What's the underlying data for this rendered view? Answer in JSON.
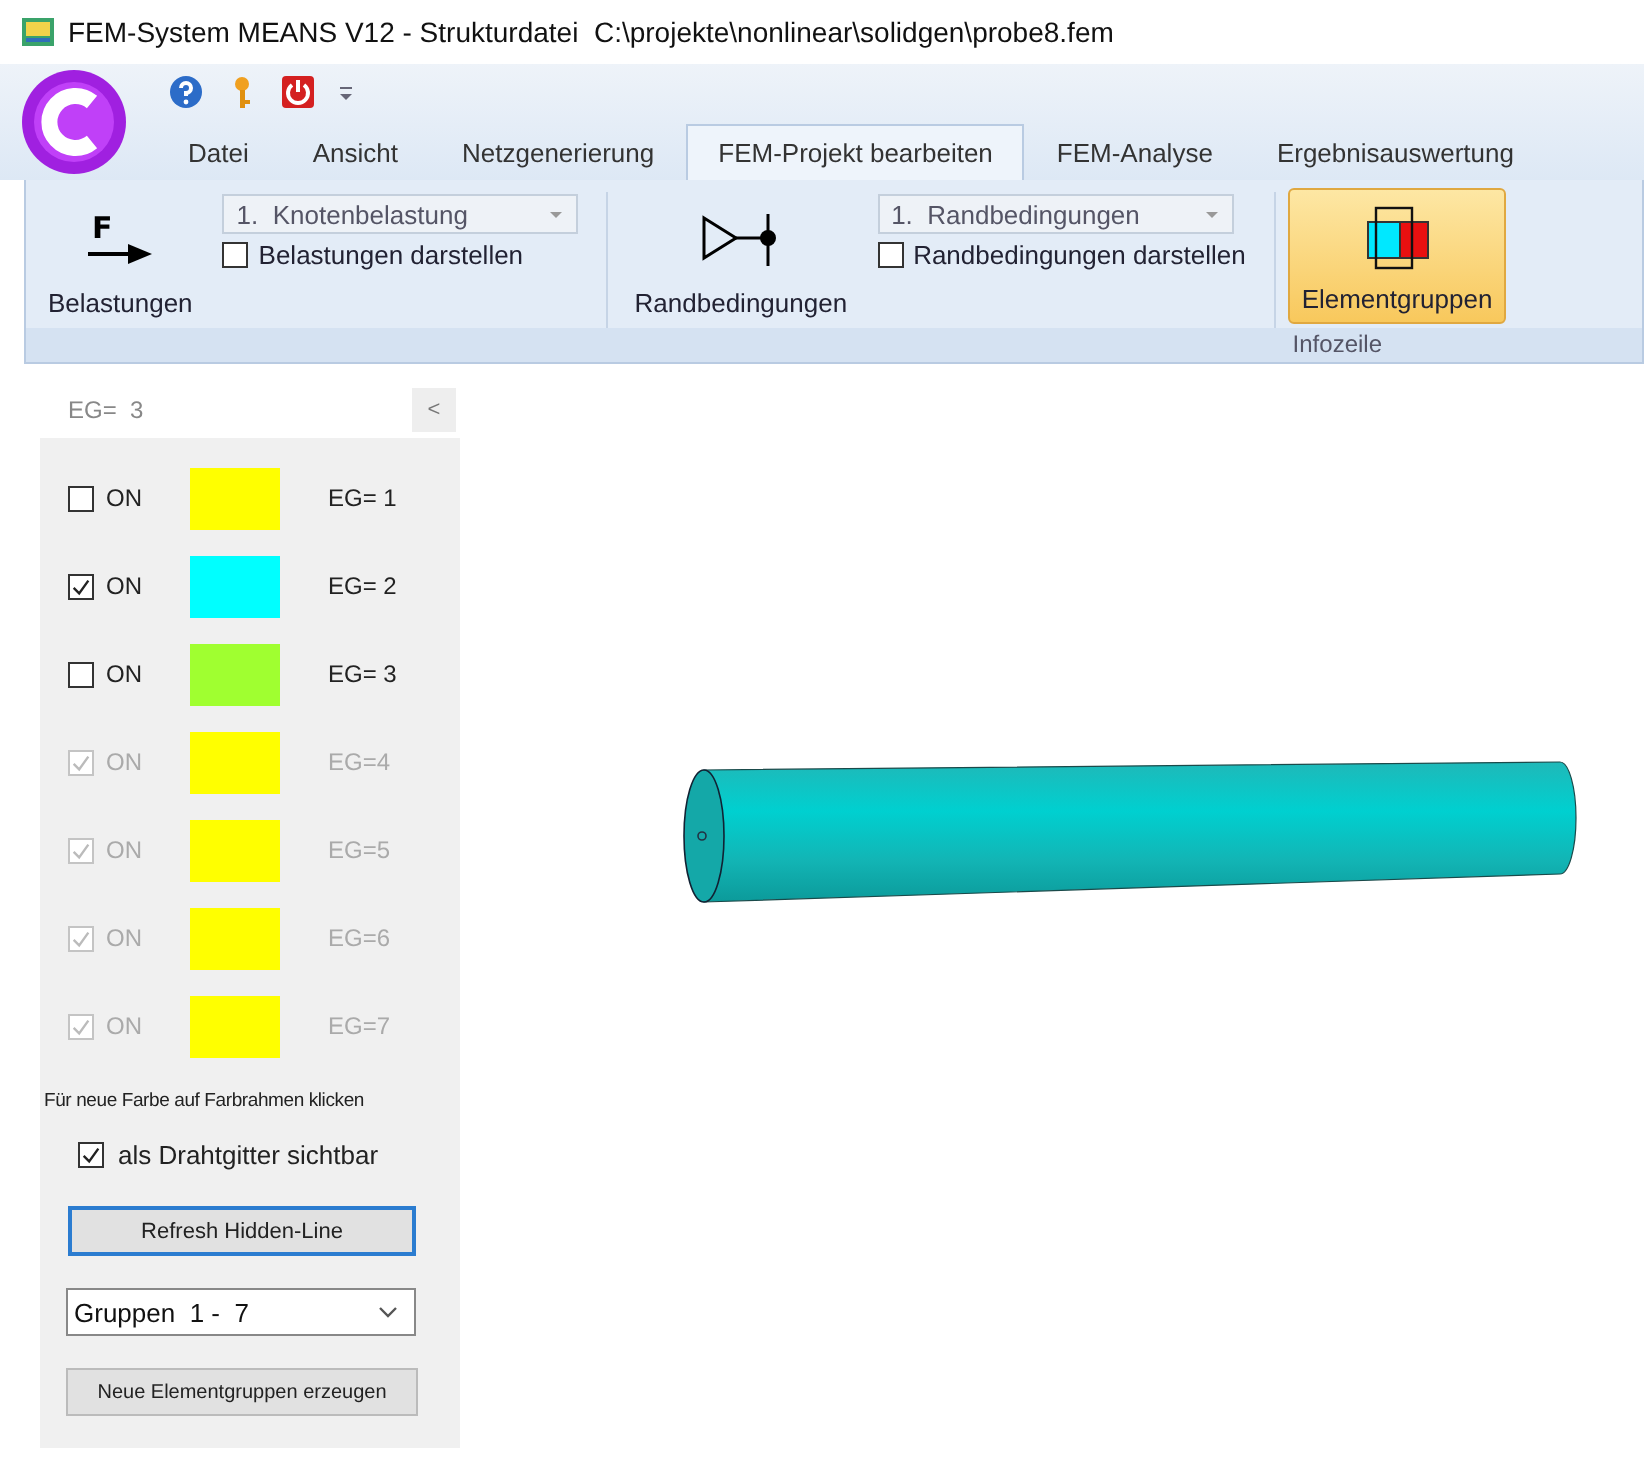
{
  "window": {
    "title": "FEM-System MEANS V12 - Strukturdatei  C:\\projekte\\nonlinear\\solidgen\\probe8.fem"
  },
  "tabs": [
    {
      "label": "Datei",
      "selected": false
    },
    {
      "label": "Ansicht",
      "selected": false
    },
    {
      "label": "Netzgenerierung",
      "selected": false
    },
    {
      "label": "FEM-Projekt bearbeiten",
      "selected": true
    },
    {
      "label": "FEM-Analyse",
      "selected": false
    },
    {
      "label": "Ergebnisauswertung",
      "selected": false
    }
  ],
  "ribbon": {
    "loads": {
      "button": "Belastungen",
      "icon_letter": "F",
      "dropdown": "1.  Knotenbelastung",
      "checkbox": {
        "label": "Belastungen darstellen",
        "checked": false
      }
    },
    "boundary": {
      "button": "Randbedingungen",
      "dropdown": "1.  Randbedingungen",
      "checkbox": {
        "label": "Randbedingungen darstellen",
        "checked": false
      }
    },
    "element_groups": {
      "button": "Elementgruppen",
      "selected": true
    },
    "group_label": "Infozeile"
  },
  "panel": {
    "header": "EG=  3",
    "collapse": "<",
    "groups": [
      {
        "label": "ON",
        "checked": false,
        "disabled": false,
        "color": "#ffff00",
        "name": "EG= 1"
      },
      {
        "label": "ON",
        "checked": true,
        "disabled": false,
        "color": "#00ffff",
        "name": "EG= 2"
      },
      {
        "label": "ON",
        "checked": false,
        "disabled": false,
        "color": "#a0ff30",
        "name": "EG= 3"
      },
      {
        "label": "ON",
        "checked": true,
        "disabled": true,
        "color": "#ffff00",
        "name": "EG=4"
      },
      {
        "label": "ON",
        "checked": true,
        "disabled": true,
        "color": "#ffff00",
        "name": "EG=5"
      },
      {
        "label": "ON",
        "checked": true,
        "disabled": true,
        "color": "#ffff00",
        "name": "EG=6"
      },
      {
        "label": "ON",
        "checked": true,
        "disabled": true,
        "color": "#ffff00",
        "name": "EG=7"
      }
    ],
    "hint": "Für neue Farbe auf Farbrahmen klicken",
    "wireframe": {
      "label": "als Drahtgitter sichtbar",
      "checked": true
    },
    "refresh_button": "Refresh Hidden-Line",
    "range_select": "Gruppen  1 -  7",
    "create_button": "Neue Elementgruppen erzeugen"
  }
}
